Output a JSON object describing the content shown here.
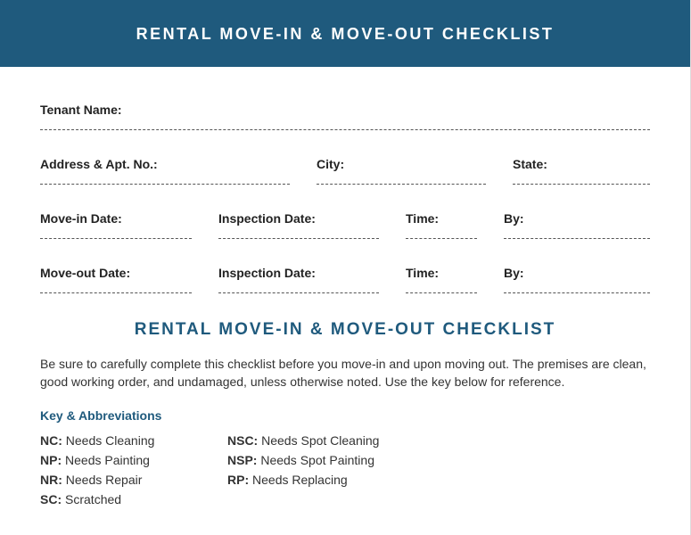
{
  "header": {
    "title": "RENTAL MOVE-IN & MOVE-OUT CHECKLIST"
  },
  "fields": {
    "tenant_name": "Tenant Name:",
    "address_apt": "Address & Apt. No.:",
    "city": "City:",
    "state": "State:",
    "move_in_date": "Move-in Date:",
    "inspection_date_in": "Inspection Date:",
    "time_in": "Time:",
    "by_in": "By:",
    "move_out_date": "Move-out Date:",
    "inspection_date_out": "Inspection Date:",
    "time_out": "Time:",
    "by_out": "By:"
  },
  "section_title": "RENTAL MOVE-IN & MOVE-OUT CHECKLIST",
  "instructions": "Be sure to carefully complete this checklist before you move-in and upon moving out. The premises are clean, good working order, and undamaged, unless otherwise noted. Use the key below for reference.",
  "key_heading": "Key & Abbreviations",
  "key": {
    "col1": [
      {
        "code": "NC:",
        "desc": " Needs Cleaning"
      },
      {
        "code": "NP:",
        "desc": " Needs Painting"
      },
      {
        "code": "NR:",
        "desc": " Needs Repair"
      },
      {
        "code": "SC:",
        "desc": " Scratched"
      }
    ],
    "col2": [
      {
        "code": "NSC:",
        "desc": " Needs Spot Cleaning"
      },
      {
        "code": "NSP:",
        "desc": " Needs Spot Painting"
      },
      {
        "code": "RP:",
        "desc": " Needs Replacing"
      }
    ]
  }
}
